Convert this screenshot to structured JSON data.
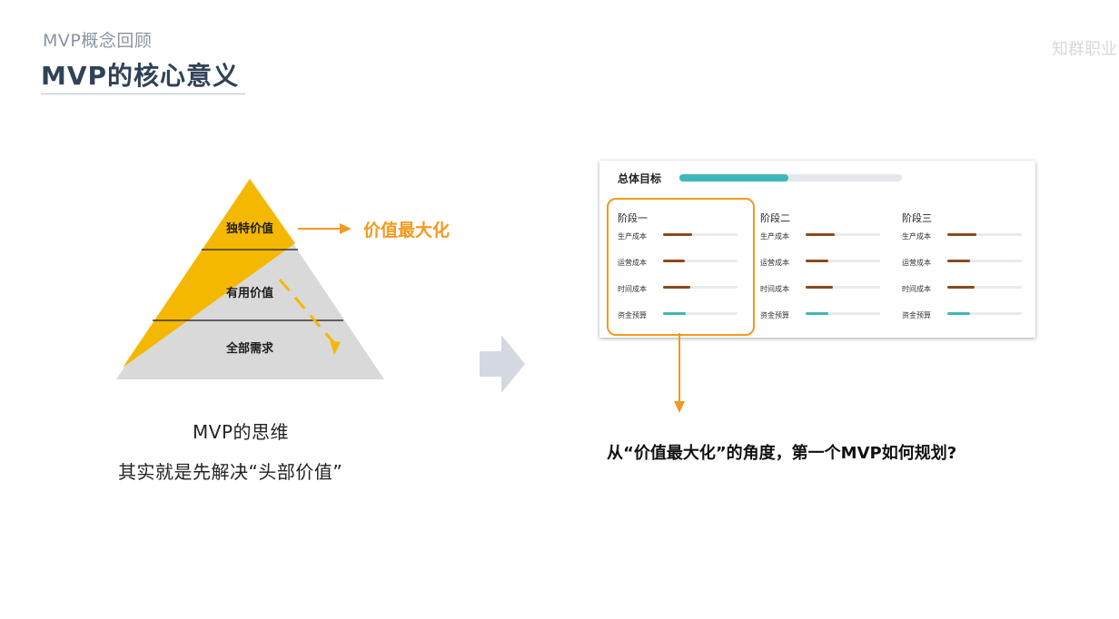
{
  "header": {
    "subtitle": "MVP概念回顾",
    "title": "MVP的核心意义",
    "watermark": "知群职业"
  },
  "pyramid": {
    "layers": [
      "独特价值",
      "有用价值",
      "全部需求"
    ],
    "value_label": "价值最大化",
    "colors": {
      "yellow": "#f5b800",
      "gray": "#d9d9d9",
      "accent": "#f39a1e"
    }
  },
  "caption": {
    "line1": "MVP的思维",
    "line2": "其实就是先解决“头部价值”"
  },
  "dashboard": {
    "overall_label": "总体目标",
    "overall_progress": 0.49,
    "stages": [
      {
        "title": "阶段一",
        "rows": [
          {
            "label": "生产成本",
            "progress": 0.39,
            "color": "#8b4a1c"
          },
          {
            "label": "运营成本",
            "progress": 0.29,
            "color": "#8b4a1c"
          },
          {
            "label": "时间成本",
            "progress": 0.37,
            "color": "#8b4a1c"
          },
          {
            "label": "资金预算",
            "progress": 0.3,
            "color": "#3db7b9"
          }
        ]
      },
      {
        "title": "阶段二",
        "rows": [
          {
            "label": "生产成本",
            "progress": 0.39,
            "color": "#8b4a1c"
          },
          {
            "label": "运营成本",
            "progress": 0.3,
            "color": "#8b4a1c"
          },
          {
            "label": "时间成本",
            "progress": 0.37,
            "color": "#8b4a1c"
          },
          {
            "label": "资金预算",
            "progress": 0.3,
            "color": "#3db7b9"
          }
        ]
      },
      {
        "title": "阶段三",
        "rows": [
          {
            "label": "生产成本",
            "progress": 0.39,
            "color": "#8b4a1c"
          },
          {
            "label": "运营成本",
            "progress": 0.3,
            "color": "#8b4a1c"
          },
          {
            "label": "时间成本",
            "progress": 0.37,
            "color": "#8b4a1c"
          },
          {
            "label": "资金预算",
            "progress": 0.3,
            "color": "#3db7b9"
          }
        ]
      }
    ]
  },
  "question": "从“价值最大化”的角度，第一个MVP如何规划?"
}
